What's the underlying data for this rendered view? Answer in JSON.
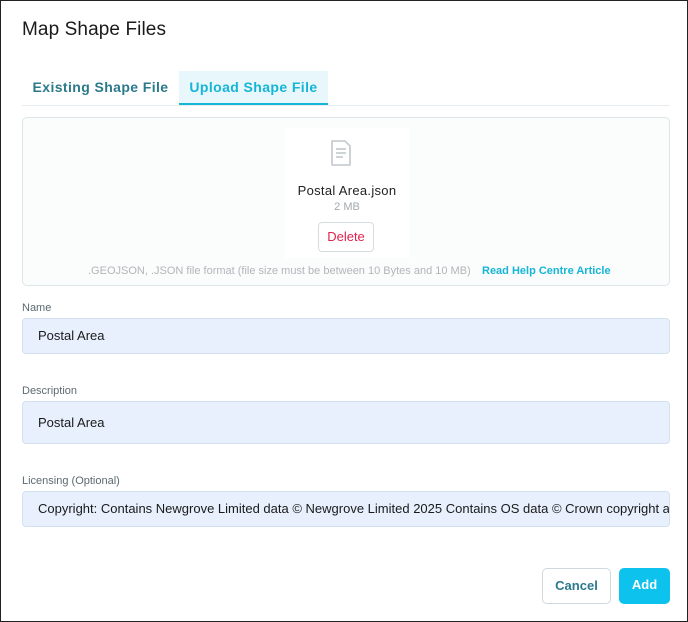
{
  "dialog": {
    "title": "Map Shape Files"
  },
  "tabs": [
    {
      "label": "Existing Shape File",
      "active": false
    },
    {
      "label": "Upload Shape File",
      "active": true
    }
  ],
  "upload": {
    "file_icon": "document-icon",
    "file_name": "Postal Area.json",
    "file_size": "2 MB",
    "delete_label": "Delete",
    "format_hint": ".GEOJSON, .JSON file format (file size must be between 10 Bytes and 10 MB)",
    "help_link": "Read Help Centre Article"
  },
  "fields": {
    "name": {
      "label": "Name",
      "value": "Postal Area"
    },
    "description": {
      "label": "Description",
      "value": "Postal Area"
    },
    "licensing": {
      "label": "Licensing (Optional)",
      "value": "Copyright:  Contains Newgrove Limited data © Newgrove Limited 2025 Contains OS data © Crown copyright an"
    }
  },
  "actions": {
    "cancel_label": "Cancel",
    "add_label": "Add"
  },
  "colors": {
    "accent": "#0ec2ee",
    "danger": "#e0224e",
    "tab_text": "#2b7a8c",
    "input_bg": "#e8f0fd"
  }
}
